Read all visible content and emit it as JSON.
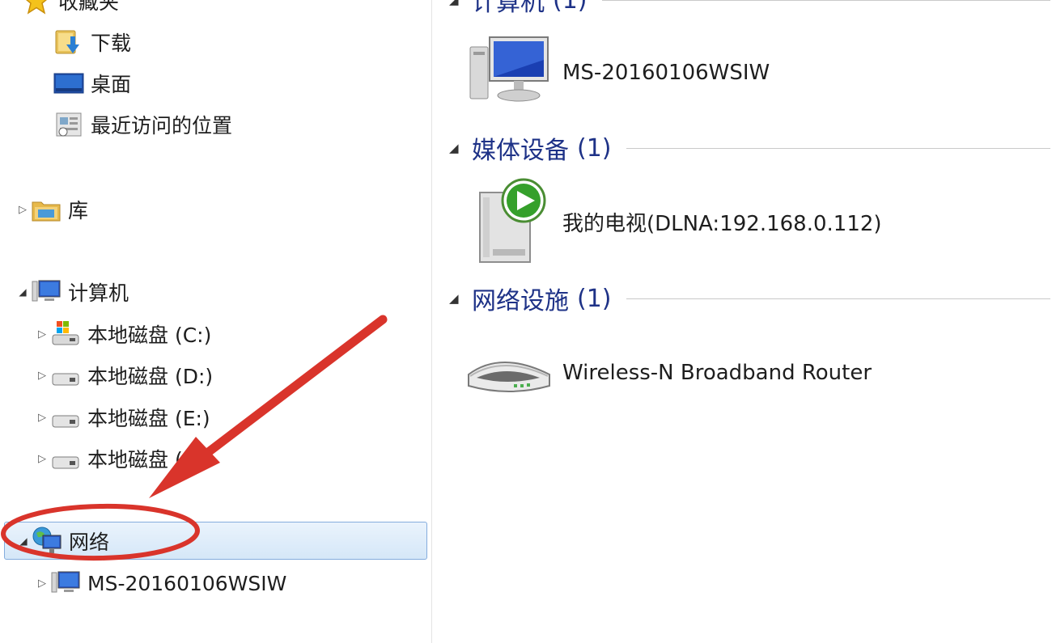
{
  "nav": {
    "favorites": {
      "label": "收藏夹",
      "icon": "star-icon"
    },
    "favorites_items": [
      {
        "label": "下载",
        "icon": "downloads-folder-icon"
      },
      {
        "label": "桌面",
        "icon": "desktop-icon"
      },
      {
        "label": "最近访问的位置",
        "icon": "recent-places-icon"
      }
    ],
    "libraries": {
      "label": "库",
      "icon": "library-folder-icon"
    },
    "computer": {
      "label": "计算机",
      "icon": "computer-icon"
    },
    "drives": [
      {
        "label": "本地磁盘 (C:)",
        "icon": "system-drive-icon"
      },
      {
        "label": "本地磁盘 (D:)",
        "icon": "drive-icon"
      },
      {
        "label": "本地磁盘 (E:)",
        "icon": "drive-icon"
      },
      {
        "label": "本地磁盘 (F:)",
        "icon": "drive-icon"
      }
    ],
    "network": {
      "label": "网络",
      "icon": "network-icon",
      "selected": true
    },
    "network_items": [
      {
        "label": "MS-20160106WSIW",
        "icon": "computer-icon"
      }
    ]
  },
  "content": {
    "groups": [
      {
        "name": "计算机",
        "count": "(1)",
        "items": [
          {
            "label": "MS-20160106WSIW",
            "icon": "computer-icon"
          }
        ]
      },
      {
        "name": "媒体设备",
        "count": "(1)",
        "items": [
          {
            "label": "我的电视(DLNA:192.168.0.112)",
            "icon": "media-device-icon"
          }
        ]
      },
      {
        "name": "网络设施",
        "count": "(1)",
        "items": [
          {
            "label": "Wireless-N Broadband Router",
            "icon": "router-icon"
          }
        ]
      }
    ]
  },
  "annotation": {
    "color": "#d9342b"
  }
}
